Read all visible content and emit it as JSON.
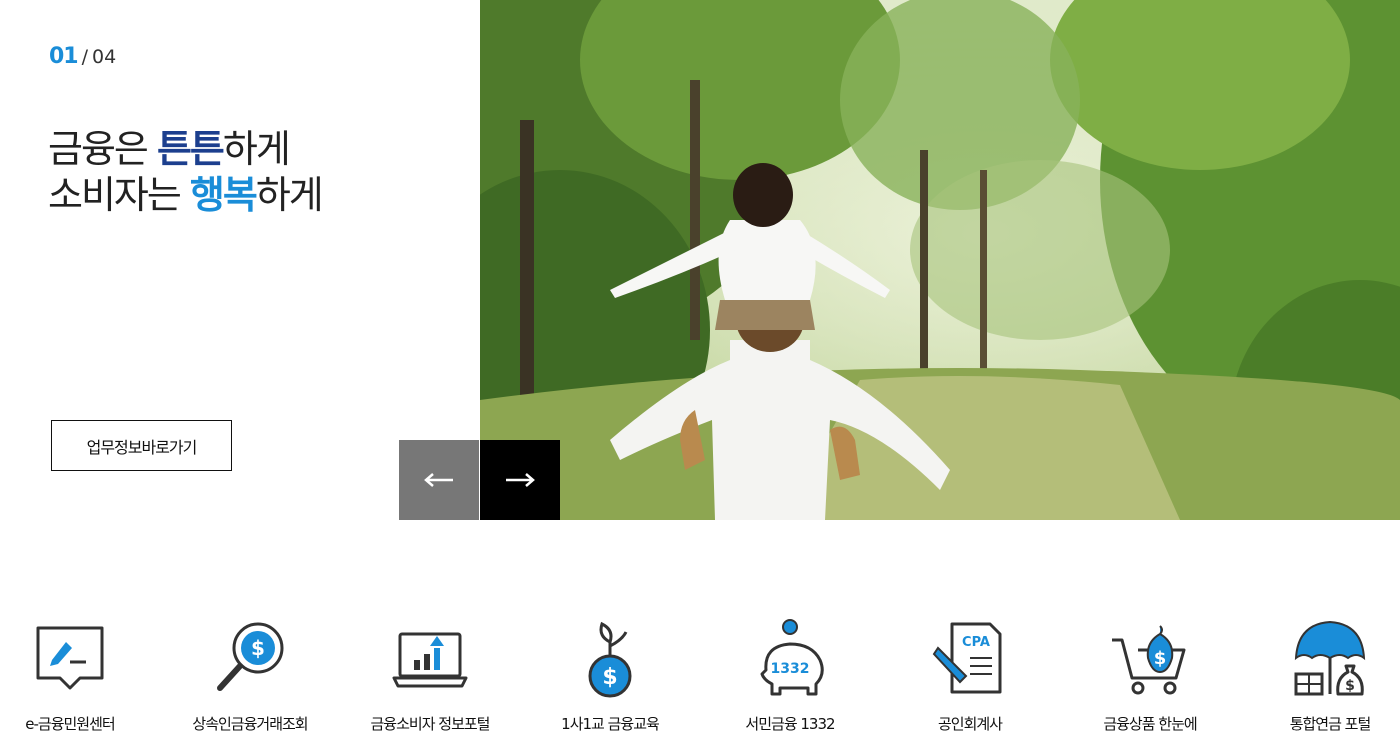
{
  "hero": {
    "counter_current": "01",
    "counter_separator": "/",
    "counter_total": "04",
    "headline_line1_a": "금융은 ",
    "headline_line1_em": "튼튼",
    "headline_line1_b": "하게",
    "headline_line2_a": "소비자는 ",
    "headline_line2_em": "행복",
    "headline_line2_b": "하게",
    "business_button_label": "업무정보바로가기",
    "prev_icon": "arrow-left-icon",
    "next_icon": "arrow-right-icon"
  },
  "quick_links": [
    {
      "label": "e-금융민원센터",
      "icon": "chat-edit-icon"
    },
    {
      "label": "상속인금융거래조회",
      "icon": "magnifier-dollar-icon"
    },
    {
      "label": "금융소비자 정보포털",
      "icon": "laptop-chart-icon"
    },
    {
      "label": "1사1교 금융교육",
      "icon": "sprout-coin-icon"
    },
    {
      "label": "서민금융 1332",
      "icon": "piggy-bank-icon",
      "badge": "1332"
    },
    {
      "label": "공인회계사",
      "icon": "cpa-document-icon",
      "badge": "CPA"
    },
    {
      "label": "금융상품 한눈에",
      "icon": "cart-money-icon"
    },
    {
      "label": "통합연금 포털",
      "icon": "umbrella-money-icon"
    }
  ],
  "colors": {
    "accent_blue": "#1a8dd8",
    "navy": "#1c3f8e",
    "icon_stroke": "#333333"
  }
}
